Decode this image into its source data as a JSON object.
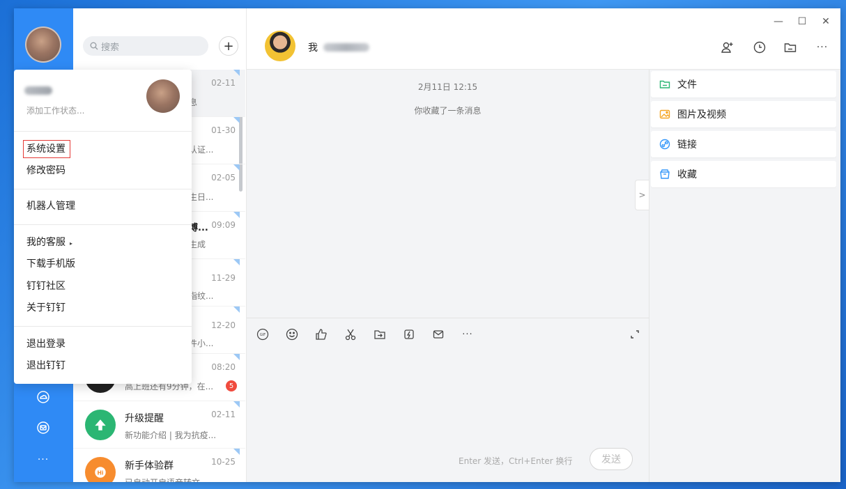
{
  "search": {
    "placeholder": "搜索"
  },
  "add_button": {
    "label": "+"
  },
  "conversations": [
    {
      "time": "02-11",
      "snippet": "息"
    },
    {
      "time": "01-30",
      "snippet": "认证..."
    },
    {
      "time": "02-05",
      "snippet": "生日..."
    },
    {
      "time": "09:09",
      "snippet": "生成",
      "title_tail": "博..."
    },
    {
      "time": "11-29",
      "snippet": "指纹..."
    },
    {
      "time": "12-20",
      "snippet": "件小..."
    },
    {
      "time": "08:20",
      "snippet": "高上班还有9分钟，在...",
      "badge": "5"
    },
    {
      "time": "02-11",
      "name": "升级提醒",
      "snippet": "新功能介绍 | 我为抗疫..."
    },
    {
      "time": "10-25",
      "name": "新手体验群",
      "snippet": "已自动开启语音转文..."
    }
  ],
  "chat": {
    "title": "我",
    "date": "2月11日 12:15",
    "system_message": "你收藏了一条消息",
    "input_hint": "Enter 发送，Ctrl+Enter 换行",
    "send_label": "发送"
  },
  "right_panel": {
    "items": [
      "文件",
      "图片及视频",
      "链接",
      "收藏"
    ]
  },
  "menu": {
    "status_placeholder": "添加工作状态...",
    "items": [
      "系统设置",
      "修改密码",
      "机器人管理",
      "我的客服",
      "下载手机版",
      "钉钉社区",
      "关于钉钉",
      "退出登录",
      "退出钉钉"
    ],
    "submenu_arrow": "▸"
  },
  "window_controls": {
    "minimize": "—",
    "maximize": "☐",
    "close": "✕"
  },
  "more_label": "···",
  "colors": {
    "rail": "#2f8af5",
    "accent": "#3296fa",
    "highlight_border": "#e53935",
    "badge": "#f04b3e",
    "upgrade_green": "#2bb673",
    "newbie_orange": "#f78c2e"
  },
  "icons": {
    "rail": [
      "cloud-icon",
      "mail-icon",
      "more-icon"
    ],
    "header": [
      "add-member-icon",
      "history-icon",
      "folder-icon",
      "more-icon"
    ],
    "composer": [
      "gif-icon",
      "emoji-icon",
      "thumbs-up-icon",
      "scissors-icon",
      "folder-send-icon",
      "flash-icon",
      "envelope-icon",
      "more-icon",
      "expand-icon"
    ]
  }
}
